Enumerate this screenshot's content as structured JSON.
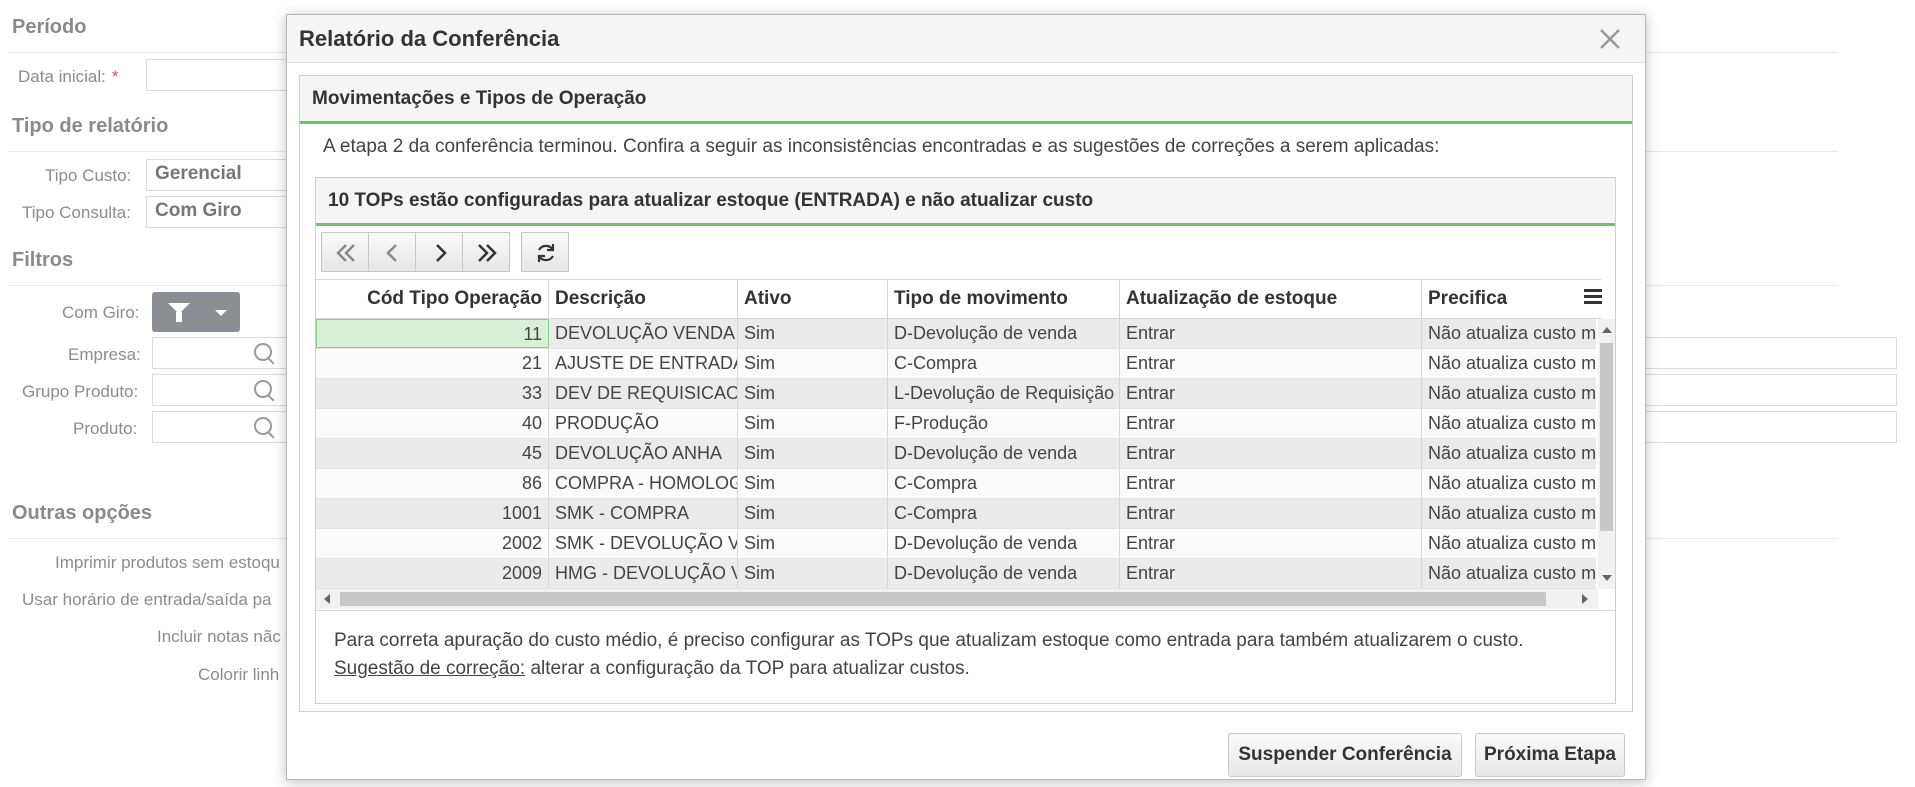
{
  "background": {
    "periodo_title": "Período",
    "data_inicial_label": "Data inicial:",
    "required_mark": "*",
    "tipo_relatorio_title": "Tipo de relatório",
    "tipo_custo_label": "Tipo Custo:",
    "tipo_custo_value": "Gerencial",
    "tipo_consulta_label": "Tipo Consulta:",
    "tipo_consulta_value": "Com Giro",
    "filtros_title": "Filtros",
    "com_giro_label": "Com Giro:",
    "empresa_label": "Empresa:",
    "grupo_produto_label": "Grupo Produto:",
    "produto_label": "Produto:",
    "outras_opcoes_title": "Outras opções",
    "imprimir_label": "Imprimir produtos sem estoqu",
    "usar_horario_label": "Usar horário de entrada/saída pa",
    "incluir_notas_label": "Incluir notas nãc",
    "colorir_label": "Colorir linh"
  },
  "modal": {
    "title": "Relatório da Conferência",
    "section_title": "Movimentações e Tipos de Operação",
    "intro": "A etapa 2 da conferência terminou. Confira a seguir as inconsistências encontradas e as sugestões de correções a serem aplicadas:",
    "issue_title": "10 TOPs estão configuradas para atualizar estoque (ENTRADA) e não atualizar custo",
    "columns": [
      "Cód Tipo Operação",
      "Descrição",
      "Ativo",
      "Tipo de movimento",
      "Atualização de estoque",
      "Precifica"
    ],
    "rows": [
      {
        "cod": "11",
        "descricao": "DEVOLUÇÃO VENDA",
        "ativo": "Sim",
        "tipo": "D-Devolução de venda",
        "atualizacao": "Entrar",
        "precifica": "Não atualiza custo m"
      },
      {
        "cod": "21",
        "descricao": "AJUSTE DE ENTRADA",
        "ativo": "Sim",
        "tipo": "C-Compra",
        "atualizacao": "Entrar",
        "precifica": "Não atualiza custo m"
      },
      {
        "cod": "33",
        "descricao": "DEV DE REQUISICAO",
        "ativo": "Sim",
        "tipo": "L-Devolução de Requisição",
        "atualizacao": "Entrar",
        "precifica": "Não atualiza custo m"
      },
      {
        "cod": "40",
        "descricao": "PRODUÇÃO",
        "ativo": "Sim",
        "tipo": "F-Produção",
        "atualizacao": "Entrar",
        "precifica": "Não atualiza custo m"
      },
      {
        "cod": "45",
        "descricao": "DEVOLUÇÃO ANHA",
        "ativo": "Sim",
        "tipo": "D-Devolução de venda",
        "atualizacao": "Entrar",
        "precifica": "Não atualiza custo m"
      },
      {
        "cod": "86",
        "descricao": "COMPRA - HOMOLOG",
        "ativo": "Sim",
        "tipo": "C-Compra",
        "atualizacao": "Entrar",
        "precifica": "Não atualiza custo m"
      },
      {
        "cod": "1001",
        "descricao": "SMK - COMPRA",
        "ativo": "Sim",
        "tipo": "C-Compra",
        "atualizacao": "Entrar",
        "precifica": "Não atualiza custo m"
      },
      {
        "cod": "2002",
        "descricao": "SMK - DEVOLUÇÃO V",
        "ativo": "Sim",
        "tipo": "D-Devolução de venda",
        "atualizacao": "Entrar",
        "precifica": "Não atualiza custo m"
      },
      {
        "cod": "2009",
        "descricao": "HMG - DEVOLUÇÃO V",
        "ativo": "Sim",
        "tipo": "D-Devolução de venda",
        "atualizacao": "Entrar",
        "precifica": "Não atualiza custo m"
      }
    ],
    "note_line1": "Para correta apuração do custo médio, é preciso configurar as TOPs que atualizam estoque como entrada para também atualizarem o custo.",
    "note_link": "Sugestão de correção:",
    "note_line2": " alterar a configuração da TOP para atualizar custos.",
    "suspend_button": "Suspender Conferência",
    "next_button": "Próxima Etapa"
  },
  "colors": {
    "accent_green": "#6cc46c",
    "selected_cell": "#d8f0d8",
    "required": "#d9534f"
  },
  "icons": [
    "search-icon",
    "filter-icon",
    "chevron-down-icon",
    "close-icon",
    "first-page-icon",
    "prev-page-icon",
    "next-page-icon",
    "last-page-icon",
    "refresh-icon",
    "column-menu-icon"
  ]
}
